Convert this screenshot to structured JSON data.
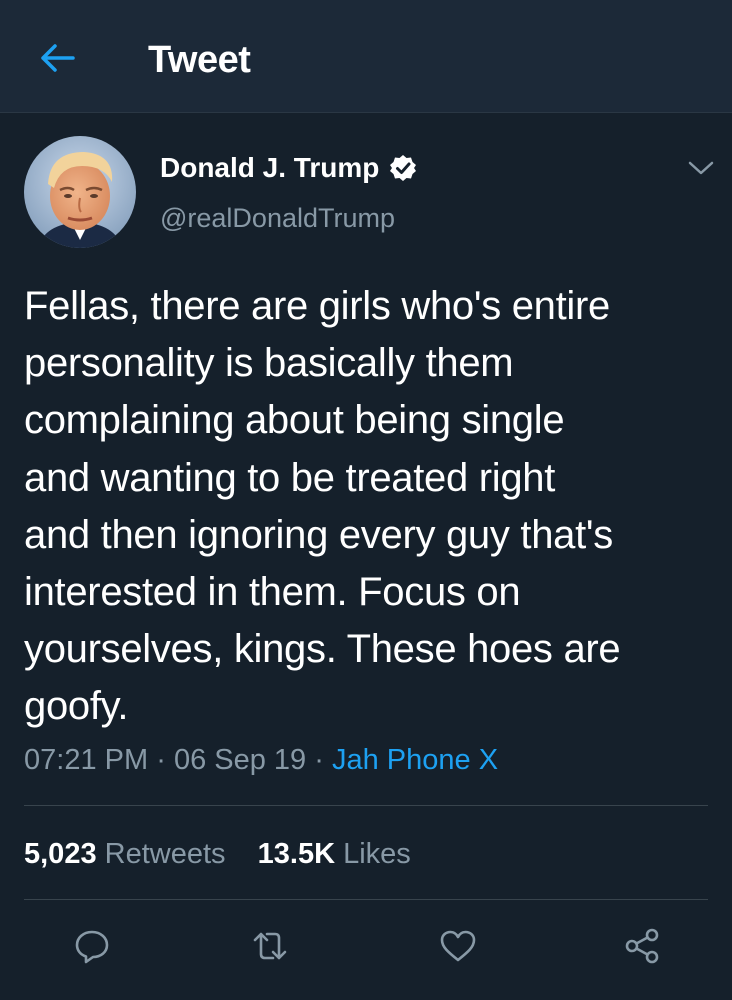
{
  "colors": {
    "background": "#15202b",
    "header_background": "#1c2938",
    "accent": "#1da1f2",
    "secondary_text": "#8899a6",
    "divider": "#38444d"
  },
  "header": {
    "back_icon": "back-arrow-icon",
    "title": "Tweet"
  },
  "author": {
    "display_name": "Donald J. Trump",
    "verified_icon": "verified-badge-icon",
    "handle": "@realDonaldTrump",
    "menu_icon": "chevron-down-icon"
  },
  "tweet": {
    "text": "Fellas, there are girls who's entire\npersonality is basically them\ncomplaining about being single\nand wanting to be treated right\nand then ignoring every guy that's\ninterested in them. Focus on\nyourselves, kings. These hoes are\ngoofy.",
    "time": "07:21 PM",
    "separator": "·",
    "date": "06 Sep 19",
    "source": "Jah Phone X"
  },
  "stats": {
    "retweets_count": "5,023",
    "retweets_label": "Retweets",
    "likes_count": "13.5K",
    "likes_label": "Likes"
  },
  "actions": [
    {
      "icon": "reply-icon"
    },
    {
      "icon": "retweet-icon"
    },
    {
      "icon": "like-heart-icon"
    },
    {
      "icon": "share-icon"
    }
  ]
}
